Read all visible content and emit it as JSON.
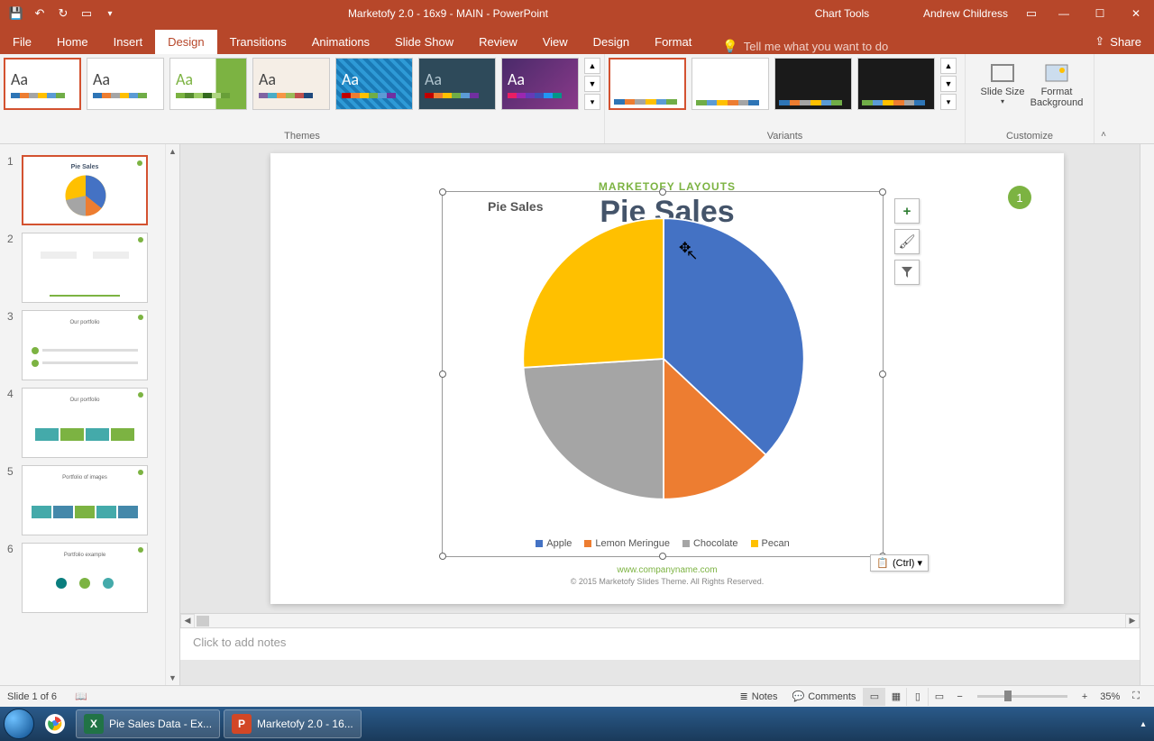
{
  "titlebar": {
    "doc_title": "Marketofy 2.0 - 16x9 - MAIN  -  PowerPoint",
    "context_tab": "Chart Tools",
    "user": "Andrew Childress"
  },
  "tabs": {
    "file": "File",
    "home": "Home",
    "insert": "Insert",
    "design": "Design",
    "transitions": "Transitions",
    "animations": "Animations",
    "slideshow": "Slide Show",
    "review": "Review",
    "view": "View",
    "design2": "Design",
    "format": "Format",
    "tellme": "Tell me what you want to do",
    "share": "Share"
  },
  "ribbon": {
    "themes_label": "Themes",
    "variants_label": "Variants",
    "customize_label": "Customize",
    "slide_size": "Slide Size",
    "format_bg": "Format Background"
  },
  "slides": {
    "count": 6,
    "active": 1
  },
  "slide": {
    "layout_label": "MARKETOFY LAYOUTS",
    "title": "Pie Sales",
    "badge": "1",
    "chart_title": "Pie Sales",
    "url": "www.companyname.com",
    "copyright": "© 2015 Marketofy Slides Theme. All Rights Reserved.",
    "paste_ctrl": "(Ctrl) ▾"
  },
  "chart_data": {
    "type": "pie",
    "title": "Pie Sales",
    "series": [
      {
        "name": "Apple",
        "value": 37,
        "color": "#4472C4"
      },
      {
        "name": "Lemon Meringue",
        "value": 13,
        "color": "#ED7D31"
      },
      {
        "name": "Chocolate",
        "value": 24,
        "color": "#A5A5A5"
      },
      {
        "name": "Pecan",
        "value": 26,
        "color": "#FFC000"
      }
    ]
  },
  "notes": {
    "placeholder": "Click to add notes"
  },
  "status": {
    "slide_of": "Slide 1 of 6",
    "notes": "Notes",
    "comments": "Comments",
    "zoom": "35%"
  },
  "taskbar": {
    "excel": "Pie Sales Data - Ex...",
    "pp": "Marketofy 2.0 - 16..."
  }
}
